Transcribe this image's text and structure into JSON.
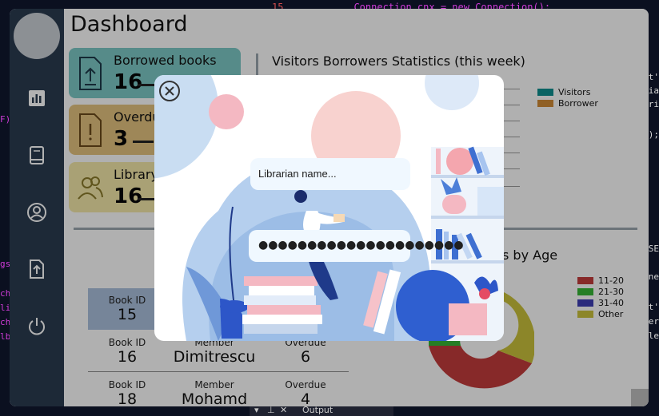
{
  "ide": {
    "line_number": "15",
    "code_line": "Connection cnx = new Connection();",
    "status_output": "Output",
    "status_glyphs": [
      "▾",
      "⊥",
      "✕"
    ],
    "left_fragments": [
      "F)",
      "gs",
      "ch",
      "li",
      "ch",
      "lb"
    ],
    "right_fragments": [
      "t'",
      "ia",
      "ri",
      "));",
      "SE",
      "ne",
      "t'",
      "er",
      "le"
    ]
  },
  "app": {
    "title": "Dashboard",
    "sidebar": {
      "items": [
        {
          "name": "statistics",
          "icon": "bar-chart-icon"
        },
        {
          "name": "books",
          "icon": "book-icon"
        },
        {
          "name": "profile",
          "icon": "user-circle-icon"
        },
        {
          "name": "export",
          "icon": "upload-file-icon"
        },
        {
          "name": "logout",
          "icon": "power-icon"
        }
      ]
    },
    "cards": [
      {
        "label": "Borrowed books",
        "value": "16",
        "icon": "upload-file-icon",
        "color": "#7cc7c4"
      },
      {
        "label": "Overdue",
        "value": "3",
        "icon": "alert-file-icon",
        "color": "#e3c27f"
      },
      {
        "label": "Library",
        "value": "16",
        "icon": "users-icon",
        "color": "#f2e7a8"
      }
    ],
    "bar_chart": {
      "title": "Visitors  Borrowers Statistics (this week)",
      "legend": [
        {
          "label": "Visitors",
          "color": "#0e8e8e"
        },
        {
          "label": "Borrower",
          "color": "#cf8a36"
        }
      ]
    },
    "donut_chart": {
      "title_fragment": "s by Age",
      "legend": [
        {
          "label": "11-20",
          "color": "#c23b3b"
        },
        {
          "label": "21-30",
          "color": "#35b535"
        },
        {
          "label": "31-40",
          "color": "#3d3db4"
        },
        {
          "label": "Other",
          "color": "#c9c13b"
        }
      ]
    },
    "table": {
      "rows": [
        {
          "book_id_label": "Book ID",
          "book_id": "15"
        },
        {
          "book_id_label": "Book ID",
          "book_id": "16",
          "member_label": "Member",
          "member": "Dimitrescu",
          "overdue_label": "Overdue",
          "overdue": "6"
        },
        {
          "book_id_label": "Book ID",
          "book_id": "18",
          "member_label": "Member",
          "member": "Mohamd",
          "overdue_label": "Overdue",
          "overdue": "4"
        }
      ]
    }
  },
  "login": {
    "name_placeholder": "Librarian name...",
    "password_value": "●●●●●●●●●●●●●●●●●●●●●",
    "close_icon": "close-circle-icon"
  }
}
